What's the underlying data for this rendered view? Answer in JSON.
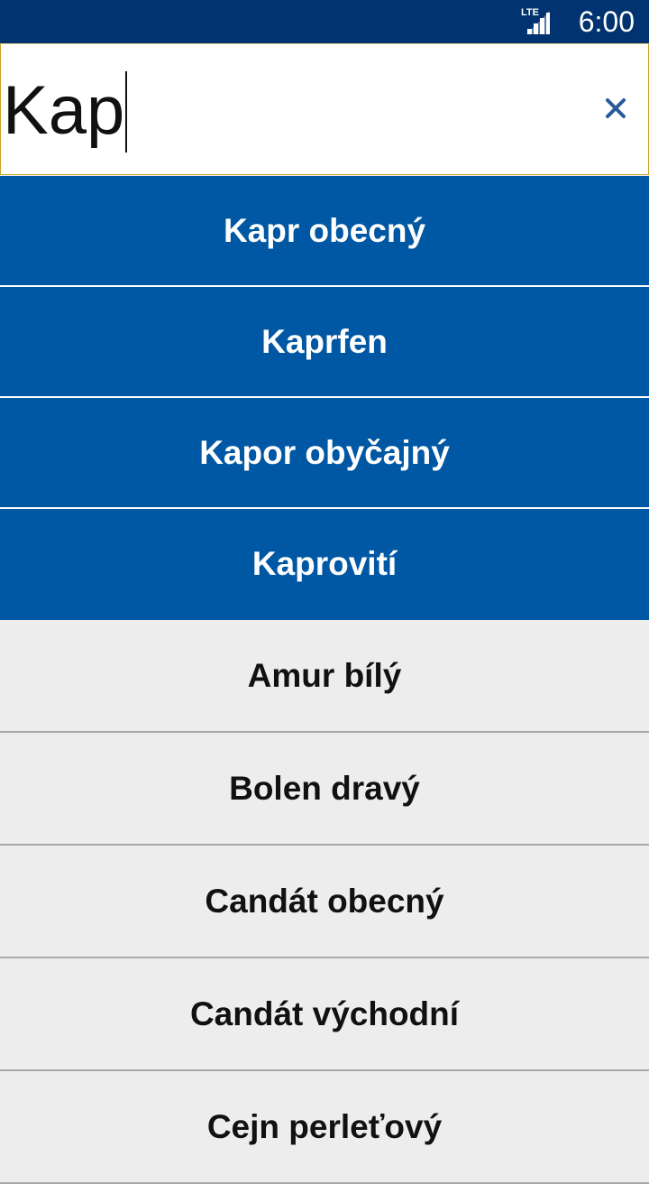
{
  "status_bar": {
    "network": "LTE",
    "time": "6:00"
  },
  "search": {
    "query": "Kap",
    "clear_icon": "close-icon"
  },
  "results": {
    "matches": [
      {
        "label": "Kapr obecný"
      },
      {
        "label": "Kaprfen"
      },
      {
        "label": "Kapor obyčajný"
      },
      {
        "label": "Kaprovití"
      }
    ],
    "items": [
      {
        "label": "Amur bílý"
      },
      {
        "label": "Bolen dravý"
      },
      {
        "label": "Candát obecný"
      },
      {
        "label": "Candát východní"
      },
      {
        "label": "Cejn perleťový"
      }
    ]
  },
  "colors": {
    "status_bar": "#003370",
    "match_row": "#0057a3",
    "list_bg": "#ededed",
    "search_border": "#c9a227",
    "clear_icon": "#2a5a9a"
  }
}
